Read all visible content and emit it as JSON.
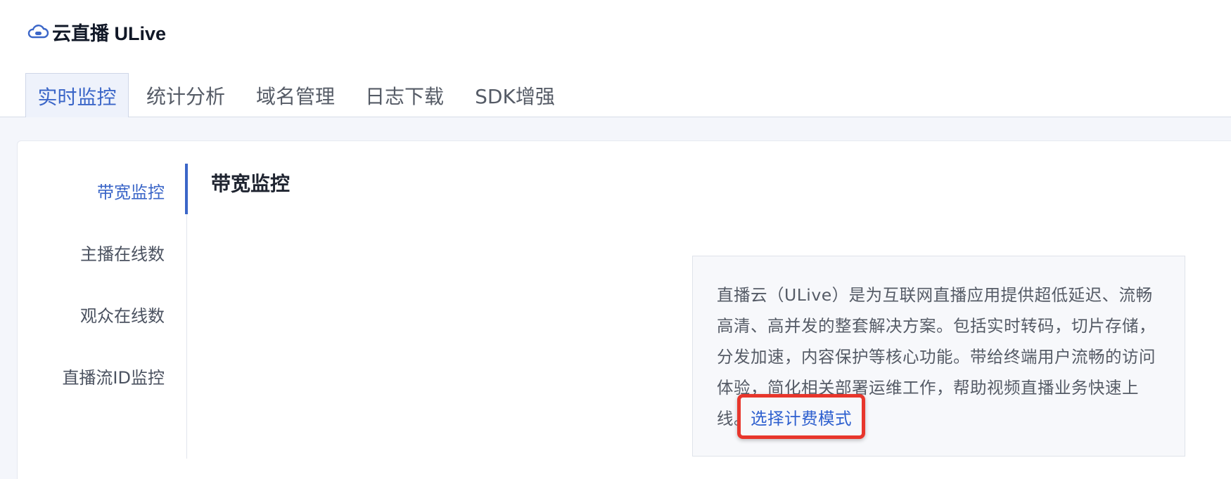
{
  "app": {
    "title": "云直播 ULive",
    "brand_icon": "cloud-play-icon",
    "accent_color": "#3b66c8"
  },
  "tabs": [
    {
      "label": "实时监控",
      "active": true
    },
    {
      "label": "统计分析",
      "active": false
    },
    {
      "label": "域名管理",
      "active": false
    },
    {
      "label": "日志下载",
      "active": false
    },
    {
      "label": "SDK增强",
      "active": false
    }
  ],
  "sidebar": {
    "items": [
      {
        "label": "带宽监控",
        "active": true
      },
      {
        "label": "主播在线数",
        "active": false
      },
      {
        "label": "观众在线数",
        "active": false
      },
      {
        "label": "直播流ID监控",
        "active": false
      }
    ]
  },
  "main": {
    "title": "带宽监控",
    "info": {
      "text": "直播云（ULive）是为互联网直播应用提供超低延迟、流畅高清、高并发的整套解决方案。包括实时转码，切片存储，分发加速，内容保护等核心功能。带给终端用户流畅的访问体验，简化相关部署运维工作，帮助视频直播业务快速上线。",
      "link_label": "选择计费模式",
      "highlight_color": "#e8362c"
    }
  }
}
